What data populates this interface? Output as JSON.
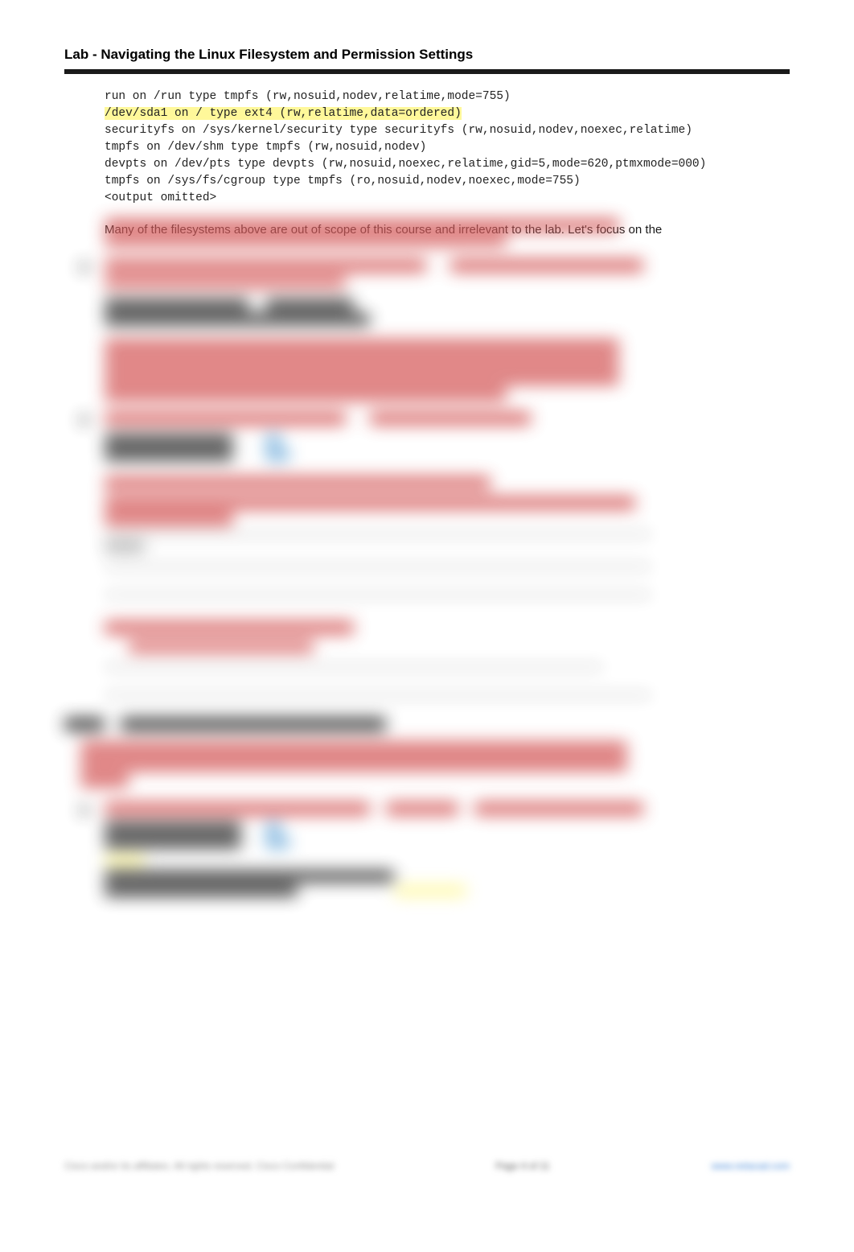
{
  "header": {
    "title": "Lab - Navigating the Linux Filesystem and Permission Settings"
  },
  "terminal": {
    "lines": [
      "run on /run type tmpfs (rw,nosuid,nodev,relatime,mode=755)",
      "/dev/sda1 on / type ext4 (rw,relatime,data=ordered)",
      "securityfs on /sys/kernel/security type securityfs (rw,nosuid,nodev,noexec,relatime)",
      "tmpfs on /dev/shm type tmpfs (rw,nosuid,nodev)",
      "devpts on /dev/pts type devpts (rw,nosuid,noexec,relatime,gid=5,mode=620,ptmxmode=000)",
      "tmpfs on /sys/fs/cgroup type tmpfs (ro,nosuid,nodev,noexec,mode=755)",
      "<output omitted>"
    ],
    "highlighted_index": 1
  },
  "body": {
    "paragraph1": "Many of the filesystems above are out of scope of this course and irrelevant to the lab. Let's focus on the"
  },
  "footer": {
    "copyright": "Cisco and/or its affiliates. All rights reserved. Cisco Confidential",
    "page": "Page 4 of 11",
    "site": "www.netacad.com"
  }
}
